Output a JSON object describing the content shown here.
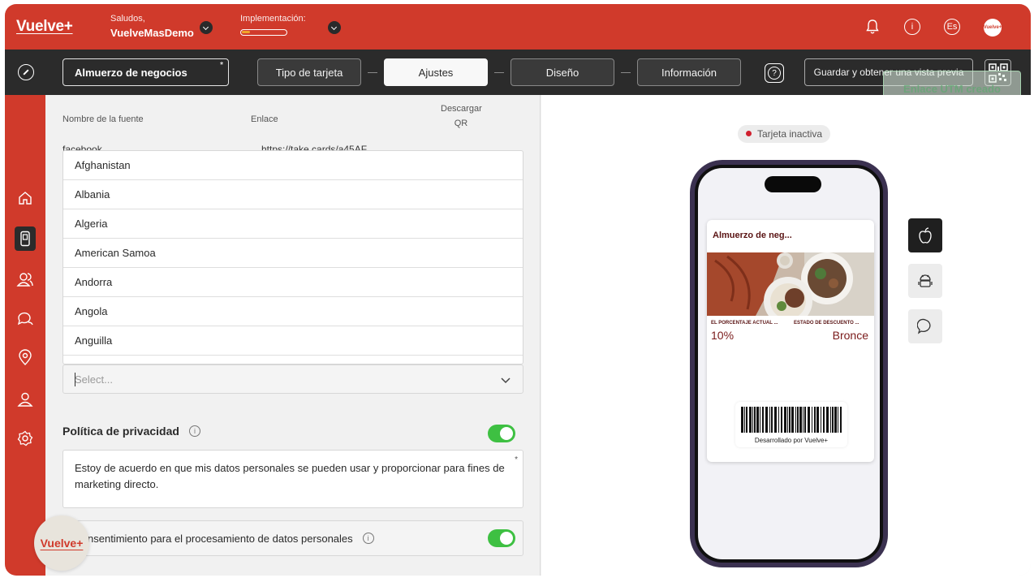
{
  "header": {
    "logo": "Vuelve+",
    "greeting_label": "Saludos,",
    "account_name": "VuelveMasDemo",
    "implementation_label": "Implementación:",
    "implementation_progress": 0.18,
    "language": "Es",
    "avatar_text": "Vuelve+"
  },
  "toolbar": {
    "card_name": "Almuerzo de negocios",
    "required_mark": "*",
    "tabs": [
      {
        "label": "Tipo de tarjeta"
      },
      {
        "label": "Ajustes"
      },
      {
        "label": "Diseño"
      },
      {
        "label": "Información"
      }
    ],
    "active_tab": "Ajustes",
    "help": "?",
    "save_label": "Guardar y obtener una vista previa"
  },
  "toast": {
    "text": "Enlace UTM creado"
  },
  "sources": {
    "col_name": "Nombre de la fuente",
    "col_link": "Enlace",
    "col_qr": "Descargar QR",
    "peek_name": "facebook",
    "peek_link": "https://take.cards/a45AF"
  },
  "country_dropdown": {
    "options": [
      "Afghanistan",
      "Albania",
      "Algeria",
      "American Samoa",
      "Andorra",
      "Angola",
      "Anguilla"
    ],
    "placeholder": "Select..."
  },
  "privacy": {
    "title": "Política de privacidad",
    "enabled": true,
    "text": "Estoy de acuerdo en que mis datos personales se pueden usar y proporcionar para fines de marketing directo.",
    "consent_label": "nsentimiento para el procesamiento de datos personales",
    "consent_enabled": true
  },
  "floating_logo": "Vuelve+",
  "preview": {
    "status": "Tarjeta inactiva",
    "card_title": "Almuerzo de neg...",
    "field1_label": "EL PORCENTAJE ACTUAL ...",
    "field1_value": "10%",
    "field2_label": "ESTADO DE DESCUENTO ...",
    "field2_value": "Bronce",
    "powered_by": "Desarrollado por Vuelve+"
  },
  "colors": {
    "brand": "#d03a2b",
    "dark": "#2b2b2b",
    "toggle": "#3ec042",
    "status_dot": "#d0202e"
  }
}
